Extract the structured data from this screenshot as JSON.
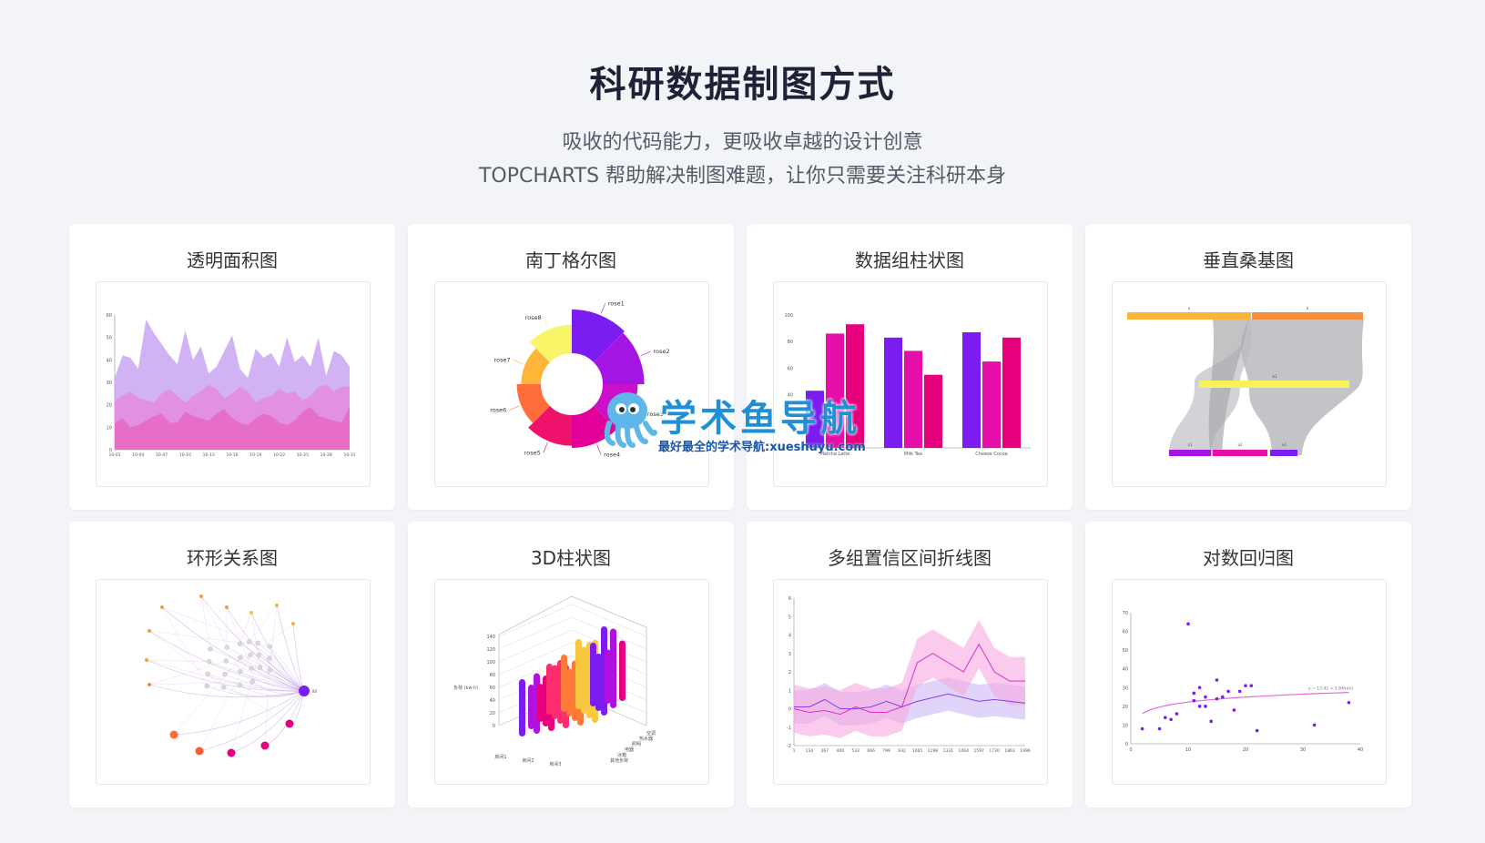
{
  "header": {
    "title": "科研数据制图方式",
    "subtitle_line1": "吸收的代码能力，更吸收卓越的设计创意",
    "subtitle_line2": "TOPCHARTS 帮助解决制图难题，让你只需要关注科研本身"
  },
  "cards": [
    {
      "title": "透明面积图"
    },
    {
      "title": "南丁格尔图"
    },
    {
      "title": "数据组柱状图"
    },
    {
      "title": "垂直桑基图"
    },
    {
      "title": "环形关系图"
    },
    {
      "title": "3D柱状图"
    },
    {
      "title": "多组置信区间折线图"
    },
    {
      "title": "对数回归图"
    }
  ],
  "watermark": {
    "text": "学术鱼导航",
    "sub": "最好最全的学术导航:xueshuyu.com"
  },
  "colors": {
    "purple": "#7b1cf0",
    "magenta": "#e6007e",
    "pink": "#ff2d9b",
    "yellow": "#f8f25a",
    "orange": "#ff8c3a",
    "area1": "#c9a5f2",
    "area2": "#e58ade",
    "area3": "#e768c2"
  },
  "chart_data": [
    {
      "type": "area",
      "x": [
        "10-01",
        "10-04",
        "10-07",
        "10-10",
        "10-13",
        "10-16",
        "10-19",
        "10-22",
        "10-25",
        "10-28",
        "10-31"
      ],
      "ylim": [
        0,
        60
      ],
      "yticks": [
        0,
        10,
        20,
        30,
        40,
        50,
        60
      ],
      "series": [
        {
          "values": [
            32,
            42,
            41,
            36,
            58,
            52,
            47,
            42,
            38,
            53,
            40,
            46,
            34,
            37,
            44,
            51,
            36,
            32,
            45,
            41,
            43,
            37,
            50,
            39,
            42,
            37,
            50,
            33,
            44,
            42,
            37
          ]
        },
        {
          "values": [
            22,
            24,
            26,
            23,
            22,
            21,
            25,
            27,
            24,
            21,
            24,
            26,
            29,
            27,
            23,
            25,
            28,
            26,
            21,
            23,
            24,
            27,
            25,
            26,
            22,
            24,
            28,
            29,
            26,
            28,
            28
          ]
        },
        {
          "values": [
            12,
            14,
            10,
            11,
            13,
            15,
            16,
            12,
            12,
            17,
            15,
            14,
            13,
            16,
            18,
            14,
            12,
            11,
            14,
            16,
            15,
            12,
            11,
            13,
            17,
            19,
            15,
            14,
            13,
            12,
            19
          ]
        }
      ]
    },
    {
      "type": "pie",
      "categories": [
        "rose1",
        "rose2",
        "rose3",
        "rose4",
        "rose5",
        "rose6",
        "rose7",
        "rose8"
      ],
      "values": [
        40,
        38,
        32,
        30,
        28,
        22,
        18,
        26
      ]
    },
    {
      "type": "bar",
      "categories": [
        "Matcha Latte",
        "Milk Tea",
        "Cheese Cocoa"
      ],
      "ylim": [
        0,
        100
      ],
      "yticks": [
        0,
        20,
        40,
        60,
        80,
        100
      ],
      "series": [
        {
          "values": [
            43,
            83,
            87
          ]
        },
        {
          "values": [
            86,
            73,
            65
          ]
        },
        {
          "values": [
            93,
            55,
            83
          ]
        }
      ]
    },
    {
      "type": "sankey",
      "nodes_top": [
        "a",
        "b"
      ],
      "node_middle": [
        "b1"
      ],
      "nodes_bottom": [
        "a1",
        "a2",
        "a3"
      ]
    },
    {
      "type": "chord",
      "center": "80"
    },
    {
      "type": "bar",
      "ylabel": "负荷 (kw·h)",
      "yticks": [
        0,
        20,
        40,
        60,
        80,
        100,
        120,
        140
      ],
      "x_categories": [
        "房间1",
        "房间2",
        "房间3"
      ],
      "y_categories": [
        "空调",
        "热水器",
        "照明",
        "电器",
        "冰箱",
        "其他负荷"
      ]
    },
    {
      "type": "line",
      "x": [
        1,
        134,
        267,
        400,
        533,
        666,
        799,
        932,
        1065,
        1198,
        1331,
        1464,
        1597,
        1730,
        1863,
        1996
      ],
      "ylim": [
        -2,
        6
      ],
      "yticks": [
        -2,
        -1,
        0,
        1,
        2,
        3,
        4,
        5,
        6
      ],
      "series": [
        {
          "values": [
            0.0,
            -0.2,
            -0.1,
            -0.3,
            0.1,
            -0.2,
            -0.2,
            0.1,
            2.5,
            3.0,
            2.5,
            2.0,
            3.5,
            2.0,
            1.5,
            1.5
          ]
        },
        {
          "values": [
            0.1,
            0.1,
            0.5,
            0.0,
            0.0,
            0.1,
            0.4,
            0.1,
            0.4,
            0.6,
            0.8,
            0.6,
            0.4,
            0.5,
            0.4,
            0.3
          ]
        }
      ]
    },
    {
      "type": "scatter",
      "xlim": [
        0,
        40
      ],
      "ylim": [
        0,
        70
      ],
      "xticks": [
        0,
        10,
        20,
        30,
        40
      ],
      "yticks": [
        0,
        10,
        20,
        30,
        40,
        50,
        60,
        70
      ],
      "annotation": "y = 13.42 + 3.84ln(x)",
      "points": [
        [
          2,
          8
        ],
        [
          5,
          8
        ],
        [
          6,
          14
        ],
        [
          7,
          13
        ],
        [
          8,
          16
        ],
        [
          10,
          64
        ],
        [
          11,
          23
        ],
        [
          11,
          27
        ],
        [
          12,
          30
        ],
        [
          12,
          20
        ],
        [
          13,
          25
        ],
        [
          13,
          20
        ],
        [
          14,
          12
        ],
        [
          15,
          24
        ],
        [
          15,
          34
        ],
        [
          16,
          25
        ],
        [
          17,
          28
        ],
        [
          18,
          18
        ],
        [
          19,
          28
        ],
        [
          20,
          31
        ],
        [
          21,
          31
        ],
        [
          22,
          7
        ],
        [
          32,
          10
        ],
        [
          38,
          22
        ]
      ]
    }
  ]
}
